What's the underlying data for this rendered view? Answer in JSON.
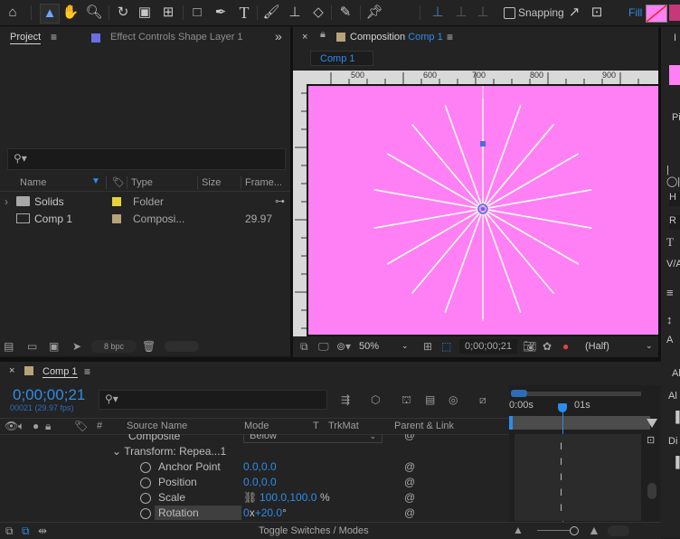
{
  "toolbar": {
    "snapping_label": "Snapping",
    "fill_label": "Fill"
  },
  "project_panel": {
    "tab_label": "Project",
    "effect_controls_label": "Effect Controls Shape Layer 1",
    "search_placeholder": "",
    "columns": {
      "name": "Name",
      "type": "Type",
      "size": "Size",
      "frame": "Frame..."
    },
    "items": [
      {
        "name": "Solids",
        "type": "Folder",
        "size": "",
        "frame": "",
        "label_color": "#e6d33c"
      },
      {
        "name": "Comp 1",
        "type": "Composi...",
        "size": "",
        "frame": "29.97",
        "label_color": "#b8a27a"
      }
    ],
    "bpc_label": "8 bpc"
  },
  "composition_panel": {
    "tab_label": "Composition",
    "tab_comp": "Comp 1",
    "sub_tab": "Comp 1",
    "ruler_ticks": [
      "500",
      "600",
      "700",
      "800",
      "900"
    ],
    "canvas_color": "#ff80f4",
    "zoom": "50%",
    "timecode": "0;00;00;21",
    "resolution": "(Half)"
  },
  "right_panel": {
    "labels": [
      "I",
      "Pi",
      "Al",
      "Di",
      "H",
      "R",
      "V/A"
    ]
  },
  "timeline": {
    "tab_label": "Comp 1",
    "timecode": "0;00;00;21",
    "timecode_sub": "00021 (29.97 fps)",
    "search_placeholder": "",
    "columns": {
      "hash": "#",
      "source": "Source Name",
      "mode": "Mode",
      "t": "T",
      "trkmat": "TrkMat",
      "parent": "Parent & Link"
    },
    "time_labels": [
      "0:00s",
      "01s"
    ],
    "composite_label": "Composite",
    "composite_value": "Below",
    "transform_label": "Transform: Repea...1",
    "properties": [
      {
        "name": "Anchor Point",
        "value": "0.0,0.0"
      },
      {
        "name": "Position",
        "value": "0.0,0.0"
      },
      {
        "name": "Scale",
        "value": "100.0,100.0",
        "suffix": "%"
      },
      {
        "name": "Rotation",
        "value_prefix": "0",
        "value_mid": "x",
        "value": "+20.0",
        "suffix": "°"
      }
    ],
    "toggle_label": "Toggle Switches / Modes"
  }
}
